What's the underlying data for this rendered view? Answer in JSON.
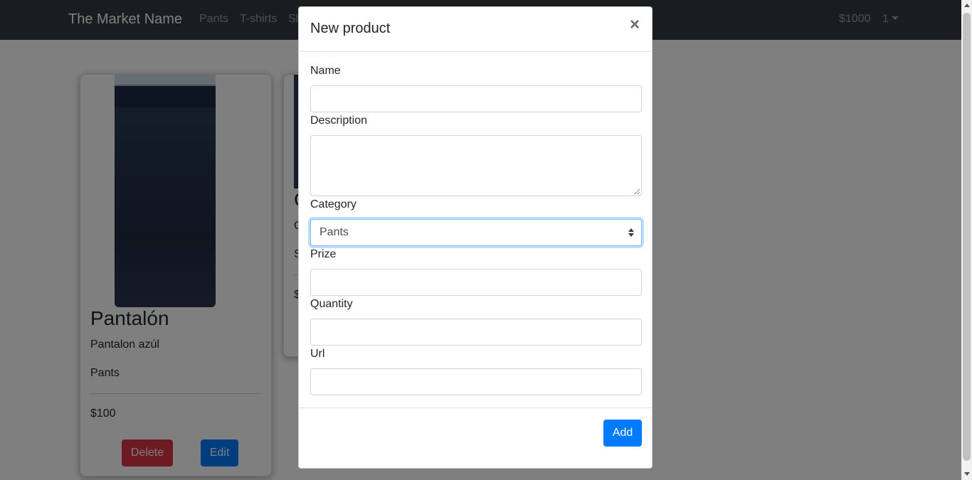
{
  "navbar": {
    "brand": "The Market Name",
    "links": [
      "Pants",
      "T-shirts",
      "Sh"
    ],
    "balance": "$1000",
    "user": "1"
  },
  "cards": [
    {
      "title": "Pantalón",
      "description": "Pantalon azúl",
      "category": "Pants",
      "price": "$100",
      "delete_label": "Delete",
      "edit_label": "Edit"
    },
    {
      "title": "C",
      "description": "C",
      "category": "S",
      "price": "$"
    }
  ],
  "modal": {
    "title": "New product",
    "close_symbol": "×",
    "fields": {
      "name_label": "Name",
      "description_label": "Description",
      "category_label": "Category",
      "category_value": "Pants",
      "prize_label": "Prize",
      "quantity_label": "Quantity",
      "url_label": "Url"
    },
    "add_label": "Add"
  },
  "colors": {
    "navbar": "#343a40",
    "primary": "#007bff",
    "danger": "#dc3545",
    "focus_border": "#80bdff"
  }
}
